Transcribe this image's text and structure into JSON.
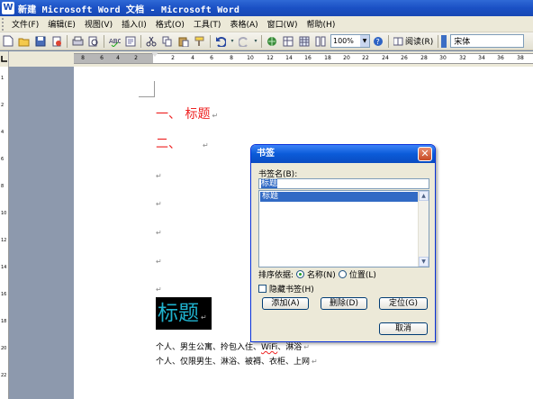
{
  "window": {
    "title": "新建 Microsoft Word 文档 - Microsoft Word",
    "app_icon": "W"
  },
  "menu": [
    "文件(F)",
    "编辑(E)",
    "视图(V)",
    "插入(I)",
    "格式(O)",
    "工具(T)",
    "表格(A)",
    "窗口(W)",
    "帮助(H)"
  ],
  "toolbar": {
    "zoom": "100%",
    "read_label": "阅读(R)",
    "font": "宋体"
  },
  "ruler": {
    "ticks": [
      "8",
      "6",
      "4",
      "2",
      "",
      "2",
      "4",
      "6",
      "8",
      "10",
      "12",
      "14",
      "16",
      "18",
      "20",
      "22",
      "24",
      "26",
      "28",
      "30",
      "32",
      "34",
      "36",
      "38"
    ]
  },
  "vruler": {
    "ticks": [
      "1",
      "2",
      "4",
      "6",
      "8",
      "10",
      "12",
      "14",
      "16",
      "18",
      "20",
      "22"
    ]
  },
  "document": {
    "heading1": "一、 标题",
    "heading2": "二、",
    "para_mark": "↵",
    "title_big": "标题",
    "line1_pre": "个人、男生公寓、拎包入住、",
    "line1_wifi": "WiFi",
    "line1_post": "、淋浴",
    "line2": "个人、仅限男生、淋浴、被褥、衣柜、上网"
  },
  "dialog": {
    "title": "书签",
    "name_label": "书签名(B):",
    "name_value": "标题",
    "list_items": [
      "标题"
    ],
    "sort_label": "排序依据:",
    "sort_name": "名称(N)",
    "sort_location": "位置(L)",
    "hide_label": "隐藏书签(H)",
    "btn_add": "添加(A)",
    "btn_delete": "删除(D)",
    "btn_goto": "定位(G)",
    "btn_cancel": "取消"
  }
}
